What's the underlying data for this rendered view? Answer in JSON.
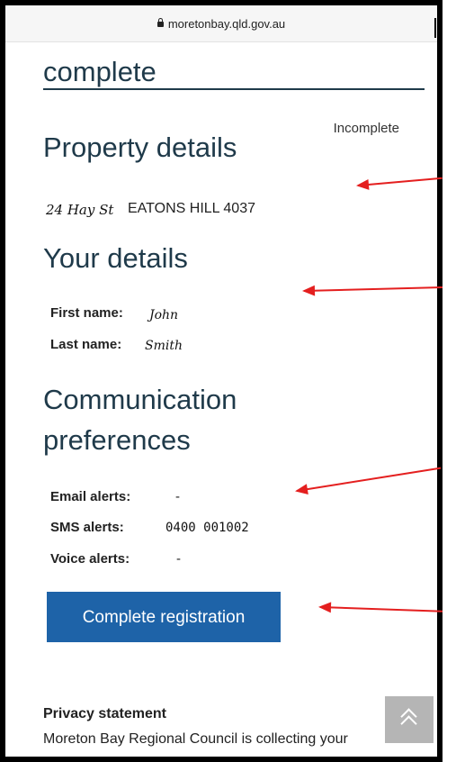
{
  "browser": {
    "url": "moretonbay.qld.gov.au"
  },
  "page": {
    "section_complete_title": "complete",
    "status": "Incomplete",
    "property": {
      "heading": "Property details",
      "street": "24 Hay St",
      "town": "EATONS HILL 4037"
    },
    "your_details": {
      "heading": "Your details",
      "first_name_label": "First name:",
      "first_name": "John",
      "last_name_label": "Last name:",
      "last_name": "Smith"
    },
    "communication": {
      "heading_line1": "Communication",
      "heading_line2": "preferences",
      "email_label": "Email alerts:",
      "email_value": "-",
      "sms_label": "SMS alerts:",
      "sms_value": "0400 001002",
      "voice_label": "Voice alerts:",
      "voice_value": "-"
    },
    "submit_label": "Complete registration",
    "privacy": {
      "heading": "Privacy statement",
      "text": "Moreton Bay Regional Council is collecting your"
    }
  },
  "icons": {
    "lock": "lock-icon",
    "back_to_top": "chevron-up-icon"
  },
  "colors": {
    "button": "#1e63a8",
    "heading": "#1f3a4a",
    "annotation_arrow": "#e41f1f"
  }
}
